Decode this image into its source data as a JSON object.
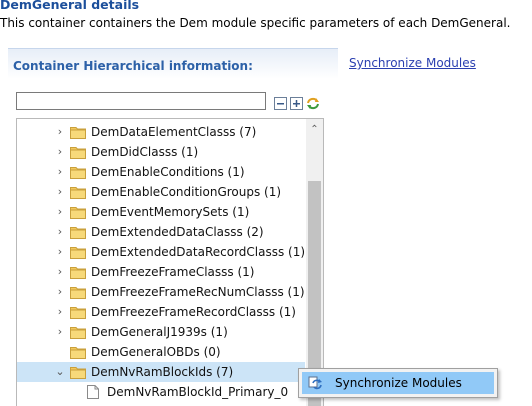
{
  "page": {
    "title": "DemGeneral details",
    "description": "This container containers the Dem module specific parameters of each DemGeneral."
  },
  "section": {
    "title": "Container Hierarchical information:",
    "sync_link": "Synchronize Modules"
  },
  "filter": {
    "value": "",
    "placeholder": ""
  },
  "toolbar": {
    "icons": [
      "collapse-all-icon",
      "expand-all-icon",
      "synchronize-icon"
    ]
  },
  "tree": {
    "items": [
      {
        "label": "DemDataElementClasss (7)",
        "expander": ">",
        "icon": "folder-icon"
      },
      {
        "label": "DemDidClasss (1)",
        "expander": ">",
        "icon": "folder-icon"
      },
      {
        "label": "DemEnableConditions (1)",
        "expander": ">",
        "icon": "folder-icon"
      },
      {
        "label": "DemEnableConditionGroups (1)",
        "expander": ">",
        "icon": "folder-icon"
      },
      {
        "label": "DemEventMemorySets (1)",
        "expander": ">",
        "icon": "folder-icon"
      },
      {
        "label": "DemExtendedDataClasss (2)",
        "expander": ">",
        "icon": "folder-icon"
      },
      {
        "label": "DemExtendedDataRecordClasss (1)",
        "expander": ">",
        "icon": "folder-icon"
      },
      {
        "label": "DemFreezeFrameClasss (1)",
        "expander": ">",
        "icon": "folder-icon"
      },
      {
        "label": "DemFreezeFrameRecNumClasss (1)",
        "expander": ">",
        "icon": "folder-icon"
      },
      {
        "label": "DemFreezeFrameRecordClasss (1)",
        "expander": ">",
        "icon": "folder-icon"
      },
      {
        "label": "DemGeneralJ1939s (1)",
        "expander": ">",
        "icon": "folder-icon"
      },
      {
        "label": "DemGeneralOBDs (0)",
        "expander": "",
        "icon": "folder-icon"
      },
      {
        "label": "DemNvRamBlockIds (7)",
        "expander": "v",
        "icon": "open-folder-icon"
      },
      {
        "label": "DemNvRamBlockId_Primary_0",
        "expander": "",
        "icon": "file-icon"
      }
    ],
    "selected_index": 12
  },
  "scrollbar": {
    "up": "^",
    "down": "v"
  },
  "context_menu": {
    "items": [
      {
        "label": "Synchronize Modules",
        "icon": "synchronize-icon"
      }
    ]
  },
  "colors": {
    "title": "#1c4f9b",
    "section_title": "#2d61a8",
    "link": "#2a3fb0",
    "selection": "#cce4f7",
    "menu_highlight": "#91c9f7",
    "folder": "#f2c75c"
  }
}
